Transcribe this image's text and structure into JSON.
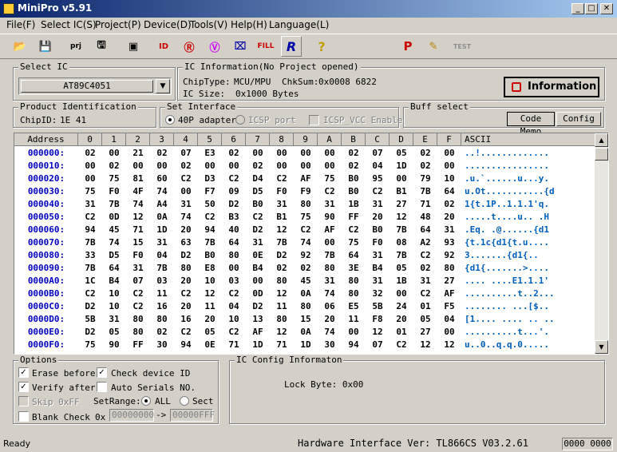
{
  "window": {
    "title": "MiniPro v5.91",
    "min": "_",
    "max": "□",
    "close": "✕"
  },
  "menu": [
    "File(F)",
    "Select IC(S)",
    "Project(P)",
    "Device(D)",
    "Tools(V)",
    "Help(H)",
    "Language(L)"
  ],
  "select_ic": {
    "label": "Select IC",
    "value": "AT89C4051"
  },
  "ic_info": {
    "label": "IC Information(No Project opened)",
    "chiptype_label": "ChipType:",
    "chiptype": "MCU/MPU",
    "chksum_label": "ChkSum:",
    "chksum": "0x0008 6822",
    "size_label": "IC Size:",
    "size": "0x1000 Bytes",
    "info_button": "Information"
  },
  "product_id": {
    "label": "Product Identification",
    "chipid_label": "ChipID:",
    "chipid": "1E 41"
  },
  "interface": {
    "label": "Set Interface",
    "opt1": "40P adapter",
    "opt2": "ICSP port",
    "opt3": "ICSP_VCC Enable"
  },
  "buff": {
    "label": "Buff select",
    "code": "Code Memo",
    "config": "Config"
  },
  "grid": {
    "headers": [
      "Address",
      "0",
      "1",
      "2",
      "3",
      "4",
      "5",
      "6",
      "7",
      "8",
      "9",
      "A",
      "B",
      "C",
      "D",
      "E",
      "F",
      "ASCII"
    ],
    "rows": [
      {
        "addr": "000000:",
        "bytes": [
          "02",
          "00",
          "21",
          "02",
          "07",
          "E3",
          "02",
          "00",
          "00",
          "00",
          "00",
          "02",
          "07",
          "05",
          "02",
          "00"
        ],
        "ascii": "..!............."
      },
      {
        "addr": "000010:",
        "bytes": [
          "00",
          "02",
          "00",
          "00",
          "02",
          "00",
          "00",
          "02",
          "00",
          "00",
          "00",
          "02",
          "04",
          "1D",
          "02",
          "00"
        ],
        "ascii": "................"
      },
      {
        "addr": "000020:",
        "bytes": [
          "00",
          "75",
          "81",
          "60",
          "C2",
          "D3",
          "C2",
          "D4",
          "C2",
          "AF",
          "75",
          "B0",
          "95",
          "00",
          "79",
          "10"
        ],
        "ascii": ".u.`......u...y."
      },
      {
        "addr": "000030:",
        "bytes": [
          "75",
          "F0",
          "4F",
          "74",
          "00",
          "F7",
          "09",
          "D5",
          "F0",
          "F9",
          "C2",
          "B0",
          "C2",
          "B1",
          "7B",
          "64"
        ],
        "ascii": "u.Ot...........{d"
      },
      {
        "addr": "000040:",
        "bytes": [
          "31",
          "7B",
          "74",
          "A4",
          "31",
          "50",
          "D2",
          "B0",
          "31",
          "80",
          "31",
          "1B",
          "31",
          "27",
          "71",
          "02"
        ],
        "ascii": "1{t.1P..1.1.1'q."
      },
      {
        "addr": "000050:",
        "bytes": [
          "C2",
          "0D",
          "12",
          "0A",
          "74",
          "C2",
          "B3",
          "C2",
          "B1",
          "75",
          "90",
          "FF",
          "20",
          "12",
          "48",
          "20"
        ],
        "ascii": ".....t....u.. .H"
      },
      {
        "addr": "000060:",
        "bytes": [
          "94",
          "45",
          "71",
          "1D",
          "20",
          "94",
          "40",
          "D2",
          "12",
          "C2",
          "AF",
          "C2",
          "B0",
          "7B",
          "64",
          "31"
        ],
        "ascii": ".Eq. .@......{d1"
      },
      {
        "addr": "000070:",
        "bytes": [
          "7B",
          "74",
          "15",
          "31",
          "63",
          "7B",
          "64",
          "31",
          "7B",
          "74",
          "00",
          "75",
          "F0",
          "08",
          "A2",
          "93"
        ],
        "ascii": "{t.1c{d1{t.u...."
      },
      {
        "addr": "000080:",
        "bytes": [
          "33",
          "D5",
          "F0",
          "04",
          "D2",
          "B0",
          "80",
          "0E",
          "D2",
          "92",
          "7B",
          "64",
          "31",
          "7B",
          "C2",
          "92"
        ],
        "ascii": "3.......{d1{.."
      },
      {
        "addr": "000090:",
        "bytes": [
          "7B",
          "64",
          "31",
          "7B",
          "80",
          "E8",
          "00",
          "B4",
          "02",
          "02",
          "80",
          "3E",
          "B4",
          "05",
          "02",
          "80"
        ],
        "ascii": "{d1{.......>...."
      },
      {
        "addr": "0000A0:",
        "bytes": [
          "1C",
          "B4",
          "07",
          "03",
          "20",
          "10",
          "03",
          "00",
          "80",
          "45",
          "31",
          "80",
          "31",
          "1B",
          "31",
          "27"
        ],
        "ascii": "....  ....E1.1.1'"
      },
      {
        "addr": "0000B0:",
        "bytes": [
          "C2",
          "10",
          "C2",
          "11",
          "C2",
          "12",
          "C2",
          "0D",
          "12",
          "0A",
          "74",
          "80",
          "32",
          "00",
          "C2",
          "AF"
        ],
        "ascii": "..........t..2..."
      },
      {
        "addr": "0000C0:",
        "bytes": [
          "D2",
          "10",
          "C2",
          "16",
          "20",
          "11",
          "04",
          "D2",
          "11",
          "80",
          "06",
          "E5",
          "5B",
          "24",
          "01",
          "F5"
        ],
        "ascii": "........ ...[$.."
      },
      {
        "addr": "0000D0:",
        "bytes": [
          "5B",
          "31",
          "80",
          "80",
          "16",
          "20",
          "10",
          "13",
          "80",
          "15",
          "20",
          "11",
          "F8",
          "20",
          "05",
          "04"
        ],
        "ascii": "[1.... .... .. .."
      },
      {
        "addr": "0000E0:",
        "bytes": [
          "D2",
          "05",
          "80",
          "02",
          "C2",
          "05",
          "C2",
          "AF",
          "12",
          "0A",
          "74",
          "00",
          "12",
          "01",
          "27",
          "00"
        ],
        "ascii": "..........t...'."
      },
      {
        "addr": "0000F0:",
        "bytes": [
          "75",
          "90",
          "FF",
          "30",
          "94",
          "0E",
          "71",
          "1D",
          "71",
          "1D",
          "30",
          "94",
          "07",
          "C2",
          "12",
          "12"
        ],
        "ascii": "u..0..q.q.0....."
      }
    ]
  },
  "options": {
    "label": "Options",
    "erase": "Erase before",
    "check_id": "Check device ID",
    "verify": "Verify after",
    "auto_serial": "Auto Serials NO.",
    "skip": "Skip 0xFF",
    "setrange": "SetRange:",
    "all": "ALL",
    "sect": "Sect",
    "blank": "Blank Check",
    "ox": "0x",
    "range_from": "00000000",
    "range_arrow": "->",
    "range_to": "00000FFF"
  },
  "config": {
    "label": "IC Config Informaton",
    "lock": "Lock Byte: 0x00"
  },
  "status": {
    "ready": "Ready",
    "hw": "Hardware Interface Ver: TL866CS V03.2.61",
    "count": "0000 0000"
  }
}
